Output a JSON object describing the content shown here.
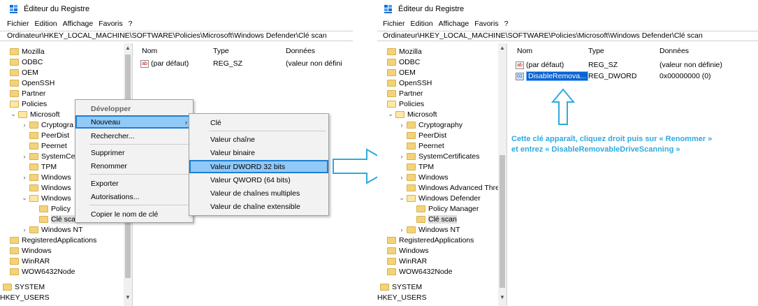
{
  "title": "Éditeur du Registre",
  "menu": [
    "Fichier",
    "Edition",
    "Affichage",
    "Favoris",
    "?"
  ],
  "left": {
    "address": "Ordinateur\\HKEY_LOCAL_MACHINE\\SOFTWARE\\Policies\\Microsoft\\Windows Defender\\Clé scan",
    "tree": [
      {
        "label": "Mozilla"
      },
      {
        "label": "ODBC"
      },
      {
        "label": "OEM"
      },
      {
        "label": "OpenSSH"
      },
      {
        "label": "Partner"
      },
      {
        "label": "Policies"
      },
      {
        "label": "Microsoft"
      },
      {
        "label": "Cryptogra"
      },
      {
        "label": "PeerDist"
      },
      {
        "label": "Peernet"
      },
      {
        "label": "SystemCe"
      },
      {
        "label": "TPM"
      },
      {
        "label": "Windows"
      },
      {
        "label": "Windows"
      },
      {
        "label": "Windows"
      },
      {
        "label": "Policy"
      },
      {
        "label": "Clé scan"
      },
      {
        "label": "Windows NT"
      },
      {
        "label": "RegisteredApplications"
      },
      {
        "label": "Windows"
      },
      {
        "label": "WinRAR"
      },
      {
        "label": "WOW6432Node"
      },
      {
        "label": "SYSTEM"
      },
      {
        "label": "HKEY_USERS"
      }
    ],
    "headers": {
      "name": "Nom",
      "type": "Type",
      "data": "Données"
    },
    "rows": [
      {
        "name": "(par défaut)",
        "type": "REG_SZ",
        "data": "(valeur non défini"
      }
    ],
    "context_menu": {
      "items": [
        "Développer",
        "Nouveau",
        "Rechercher...",
        "Supprimer",
        "Renommer",
        "Exporter",
        "Autorisations...",
        "Copier le nom de clé"
      ],
      "submenu": [
        "Clé",
        "Valeur chaîne",
        "Valeur binaire",
        "Valeur DWORD 32 bits",
        "Valeur QWORD (64 bits)",
        "Valeur de chaînes multiples",
        "Valeur de chaîne extensible"
      ],
      "arrow": "›"
    }
  },
  "right": {
    "address": "Ordinateur\\HKEY_LOCAL_MACHINE\\SOFTWARE\\Policies\\Microsoft\\Windows Defender\\Clé scan",
    "tree": [
      {
        "label": "Mozilla"
      },
      {
        "label": "ODBC"
      },
      {
        "label": "OEM"
      },
      {
        "label": "OpenSSH"
      },
      {
        "label": "Partner"
      },
      {
        "label": "Policies"
      },
      {
        "label": "Microsoft"
      },
      {
        "label": "Cryptography"
      },
      {
        "label": "PeerDist"
      },
      {
        "label": "Peernet"
      },
      {
        "label": "SystemCertificates"
      },
      {
        "label": "TPM"
      },
      {
        "label": "Windows"
      },
      {
        "label": "Windows Advanced Threa"
      },
      {
        "label": "Windows Defender"
      },
      {
        "label": "Policy Manager"
      },
      {
        "label": "Clé scan"
      },
      {
        "label": "Windows NT"
      },
      {
        "label": "RegisteredApplications"
      },
      {
        "label": "Windows"
      },
      {
        "label": "WinRAR"
      },
      {
        "label": "WOW6432Node"
      },
      {
        "label": "SYSTEM"
      },
      {
        "label": "HKEY_USERS"
      }
    ],
    "headers": {
      "name": "Nom",
      "type": "Type",
      "data": "Données"
    },
    "rows": [
      {
        "name": "(par défaut)",
        "type": "REG_SZ",
        "data": "(valeur non définie)"
      },
      {
        "name": "DisableRemova...",
        "type": "REG_DWORD",
        "data": "0x00000000 (0)"
      }
    ],
    "annotation_line1": "Cette clé apparaît, cliquez droit puis sur « Renommer »",
    "annotation_line2": "et entrez « DisableRemovableDriveScanning »"
  },
  "colors": {
    "accent": "#2eaadf",
    "highlight": "#91c9f7",
    "selection": "#0a64d0"
  }
}
